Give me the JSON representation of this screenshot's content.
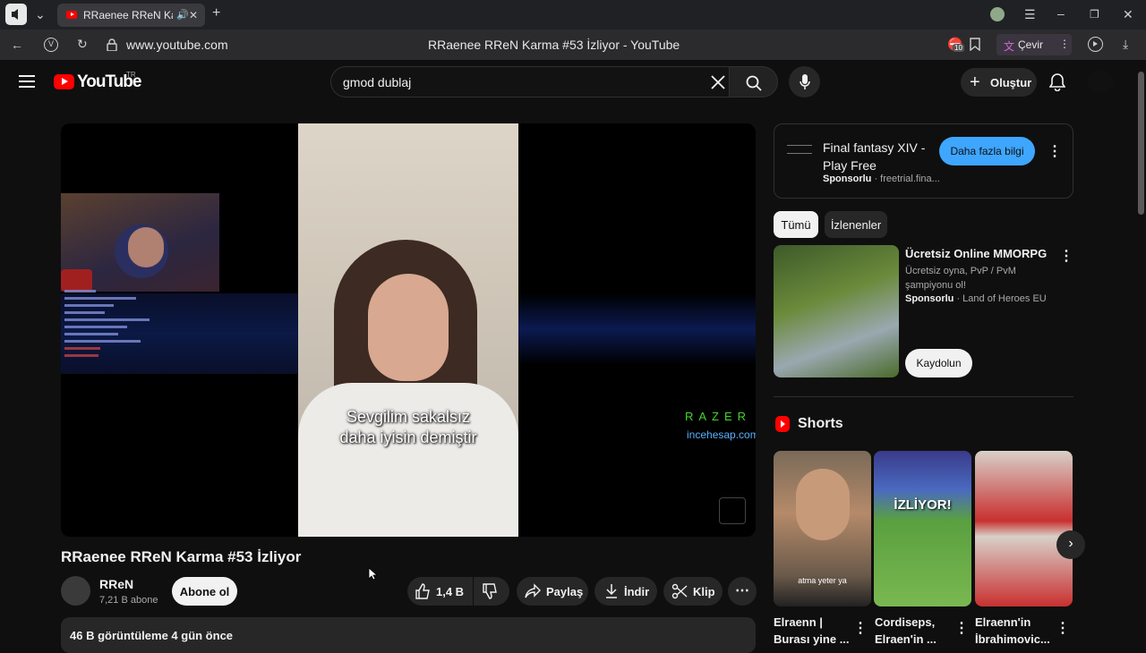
{
  "browser": {
    "tab_title": "RRaenee RReN Karma #53 İzliyor - YouTube",
    "url": "www.youtube.com",
    "page_title": "RRaenee RReN Karma #53 İzliyor - YouTube",
    "translate_label": "Çevir",
    "badge_count": "10"
  },
  "header": {
    "logo": "YouTube",
    "country": "TR",
    "search_value": "gmod dublaj",
    "create_label": "Oluştur"
  },
  "player": {
    "subtitle_line1": "Sevgilim sakalsız",
    "subtitle_line2": "daha iyisin demiştir",
    "sponsor_brand": "RAZER",
    "sponsor_site": "incehesap.com"
  },
  "video": {
    "title": "RRaenee RReN Karma #53 İzliyor",
    "channel": "RReN",
    "subscribers": "7,21 B abone",
    "subscribe_label": "Abone ol",
    "likes": "1,4 B",
    "share_label": "Paylaş",
    "download_label": "İndir",
    "clip_label": "Klip",
    "views_date": "46 B görüntüleme  4 gün önce"
  },
  "sidebar": {
    "ad": {
      "title": "Final fantasy XIV - Play Free",
      "sponsored": "Sponsorlu",
      "domain": "freetrial.fina...",
      "cta": "Daha fazla bilgi"
    },
    "chips": [
      "Tümü",
      "İzlenenler"
    ],
    "promo": {
      "title": "Ücretsiz Online MMORPG",
      "desc": "Ücretsiz oyna, PvP / PvM şampiyonu ol!",
      "sponsored": "Sponsorlu",
      "advertiser": "Land of Heroes EU",
      "cta": "Kaydolun"
    },
    "shorts_heading": "Shorts",
    "shorts": [
      {
        "title": "Elraenn | Burası yine ...",
        "overlay": "atma yeter ya"
      },
      {
        "title": "Cordiseps, Elraen'in ...",
        "overlay": "İZLİYOR!"
      },
      {
        "title": "Elraenn'in İbrahimovic...",
        "overlay": ""
      }
    ]
  },
  "colors": {
    "accent": "#ff0000",
    "link": "#3ea6ff",
    "bg": "#0f0f0f"
  }
}
